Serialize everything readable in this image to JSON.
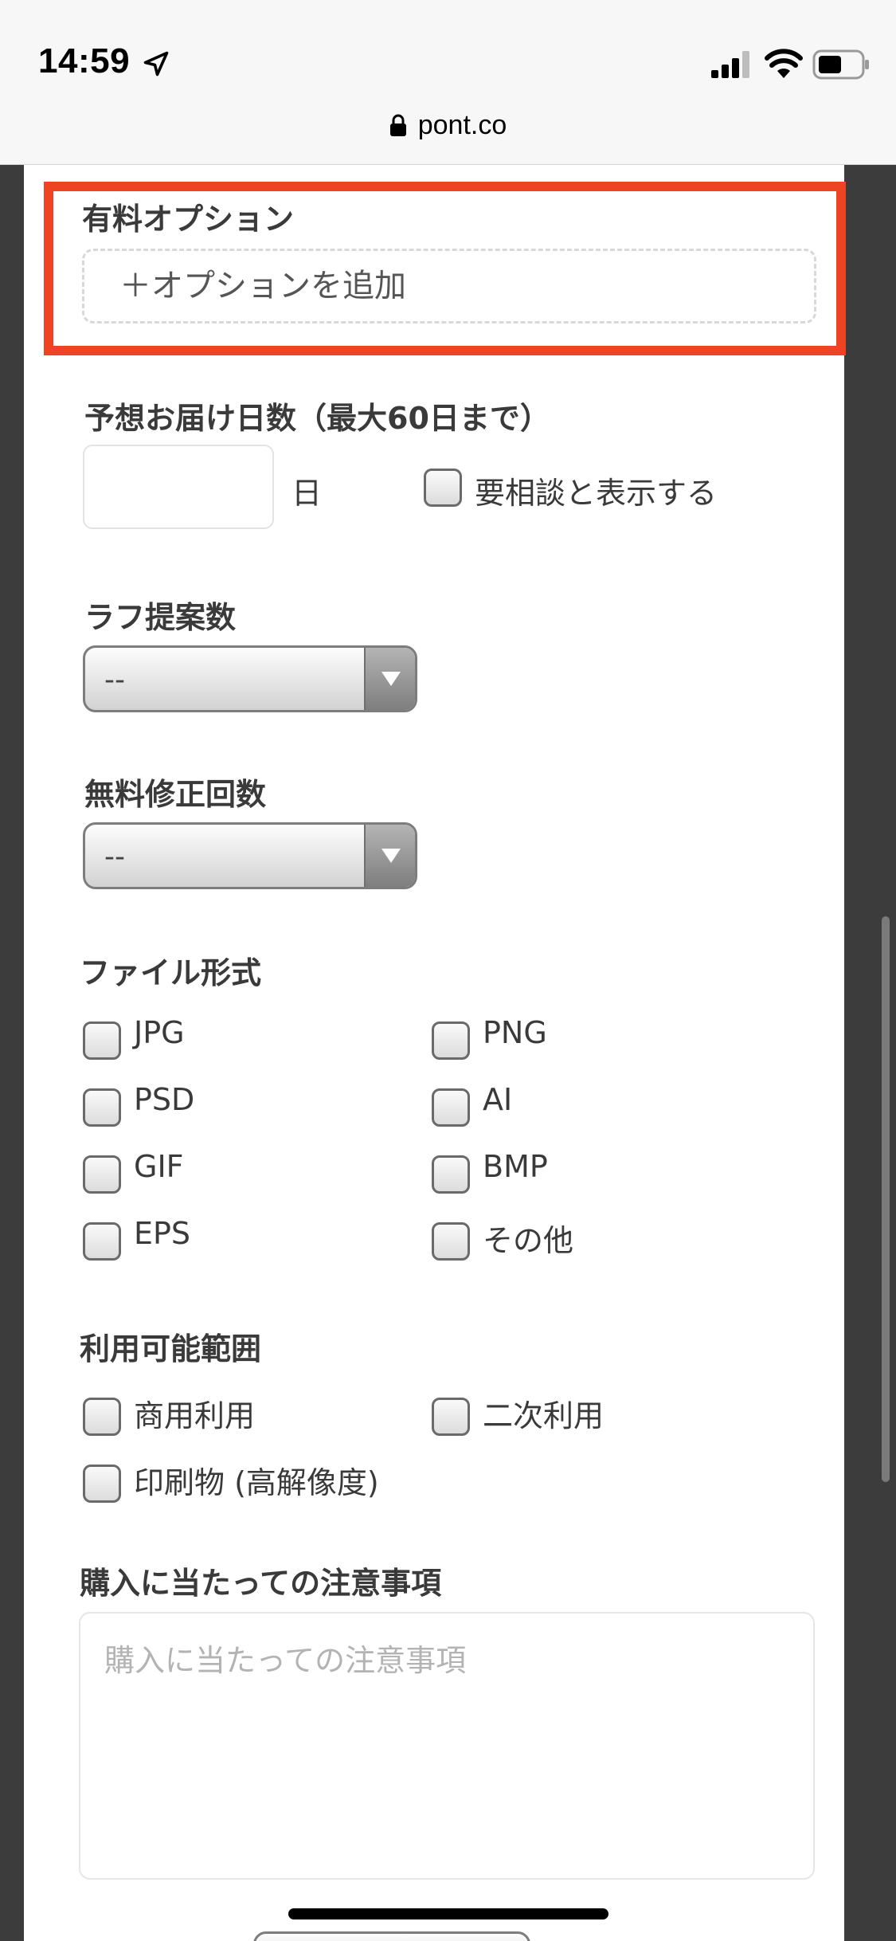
{
  "status_bar": {
    "time": "14:59",
    "url": "pont.co",
    "icons": [
      "location-arrow-icon",
      "signal-icon",
      "wifi-icon",
      "battery-icon",
      "lock-icon"
    ]
  },
  "paid_options": {
    "label": "有料オプション",
    "add_button": "＋オプションを追加",
    "highlight_color": "#ef4424"
  },
  "delivery": {
    "label": "予想お届け日数（最大60日まで）",
    "unit": "日",
    "value": "",
    "consult_checkbox": {
      "label": "要相談と表示する",
      "checked": false
    }
  },
  "rough_proposals": {
    "label": "ラフ提案数",
    "selected": "--"
  },
  "free_revisions": {
    "label": "無料修正回数",
    "selected": "--"
  },
  "file_formats": {
    "label": "ファイル形式",
    "options": [
      "JPG",
      "PNG",
      "PSD",
      "AI",
      "GIF",
      "BMP",
      "EPS",
      "その他"
    ]
  },
  "usage_scope": {
    "label": "利用可能範囲",
    "options": [
      "商用利用",
      "二次利用",
      "印刷物 (高解像度)"
    ]
  },
  "purchase_notes": {
    "label": "購入に当たっての注意事項",
    "placeholder": "購入に当たっての注意事項",
    "value": ""
  }
}
